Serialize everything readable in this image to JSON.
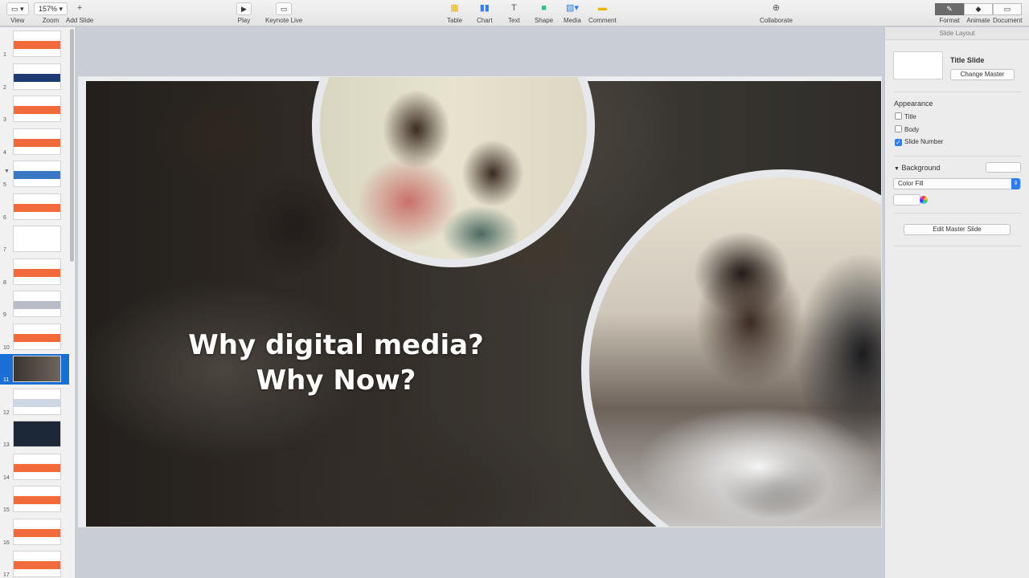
{
  "toolbar": {
    "view_label": "View",
    "zoom_value": "157%",
    "zoom_label": "Zoom",
    "add_slide_label": "Add Slide",
    "play_label": "Play",
    "keynote_live_label": "Keynote Live",
    "table_label": "Table",
    "chart_label": "Chart",
    "text_label": "Text",
    "shape_label": "Shape",
    "media_label": "Media",
    "comment_label": "Comment",
    "collaborate_label": "Collaborate",
    "format_label": "Format",
    "animate_label": "Animate",
    "document_label": "Document"
  },
  "navigator": {
    "slides": [
      {
        "num": "1"
      },
      {
        "num": "2"
      },
      {
        "num": "3"
      },
      {
        "num": "4"
      },
      {
        "num": "5"
      },
      {
        "num": "6"
      },
      {
        "num": "7"
      },
      {
        "num": "8"
      },
      {
        "num": "9"
      },
      {
        "num": "10"
      },
      {
        "num": "11"
      },
      {
        "num": "12"
      },
      {
        "num": "13"
      },
      {
        "num": "14"
      },
      {
        "num": "15"
      },
      {
        "num": "16"
      },
      {
        "num": "17"
      }
    ],
    "selected_slide": "11",
    "accent_color": "#1a6fd6"
  },
  "slide": {
    "title_line1": "Why digital media?",
    "title_line2": "Why Now?"
  },
  "inspector": {
    "header": "Slide Layout",
    "layout_name": "Title Slide",
    "change_master_label": "Change Master",
    "appearance_label": "Appearance",
    "title_check_label": "Title",
    "body_check_label": "Body",
    "slide_number_check_label": "Slide Number",
    "title_checked": false,
    "body_checked": false,
    "slide_number_checked": true,
    "background_label": "Background",
    "fill_type": "Color Fill",
    "edit_master_label": "Edit Master Slide"
  }
}
